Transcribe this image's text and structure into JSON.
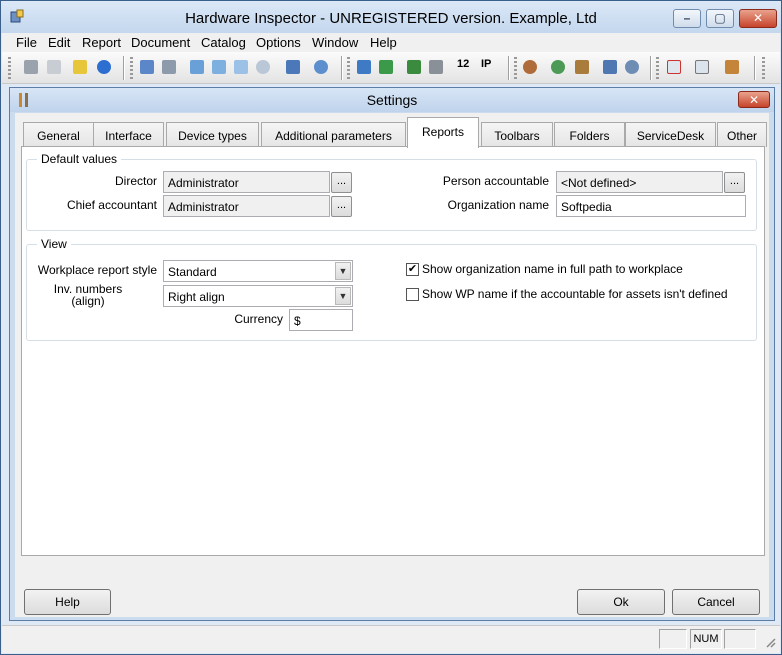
{
  "window": {
    "title": "Hardware Inspector - UNREGISTERED version. Example, Ltd",
    "min_glyph": "–",
    "max_glyph": "▢",
    "close_glyph": "✕"
  },
  "menu": [
    "File",
    "Edit",
    "Report",
    "Document",
    "Catalog",
    "Options",
    "Window",
    "Help"
  ],
  "toolbar": {
    "number_label": "12",
    "ip_label": "IP"
  },
  "dialog": {
    "title": "Settings",
    "close_glyph": "✕",
    "tabs": [
      "General",
      "Interface",
      "Device types",
      "Additional parameters",
      "Reports",
      "Toolbars",
      "Folders",
      "ServiceDesk",
      "Other"
    ],
    "active_tab": "Reports",
    "default_values": {
      "legend": "Default values",
      "director_label": "Director",
      "director_value": "Administrator",
      "chief_label": "Chief accountant",
      "chief_value": "Administrator",
      "person_label": "Person accountable",
      "person_value": "<Not defined>",
      "org_label": "Organization name",
      "org_value": "Softpedia",
      "browse_label": "..."
    },
    "view": {
      "legend": "View",
      "style_label": "Workplace report style",
      "style_value": "Standard",
      "inv_label_line1": "Inv. numbers",
      "inv_label_line2": "(align)",
      "inv_value": "Right align",
      "currency_label": "Currency",
      "currency_value": "$",
      "check1_label": "Show organization name in full path to workplace",
      "check1_checked": true,
      "check2_label": "Show WP name if the accountable for assets isn't defined",
      "check2_checked": false
    },
    "buttons": {
      "help": "Help",
      "ok": "Ok",
      "cancel": "Cancel"
    }
  },
  "statusbar": {
    "num": "NUM"
  }
}
